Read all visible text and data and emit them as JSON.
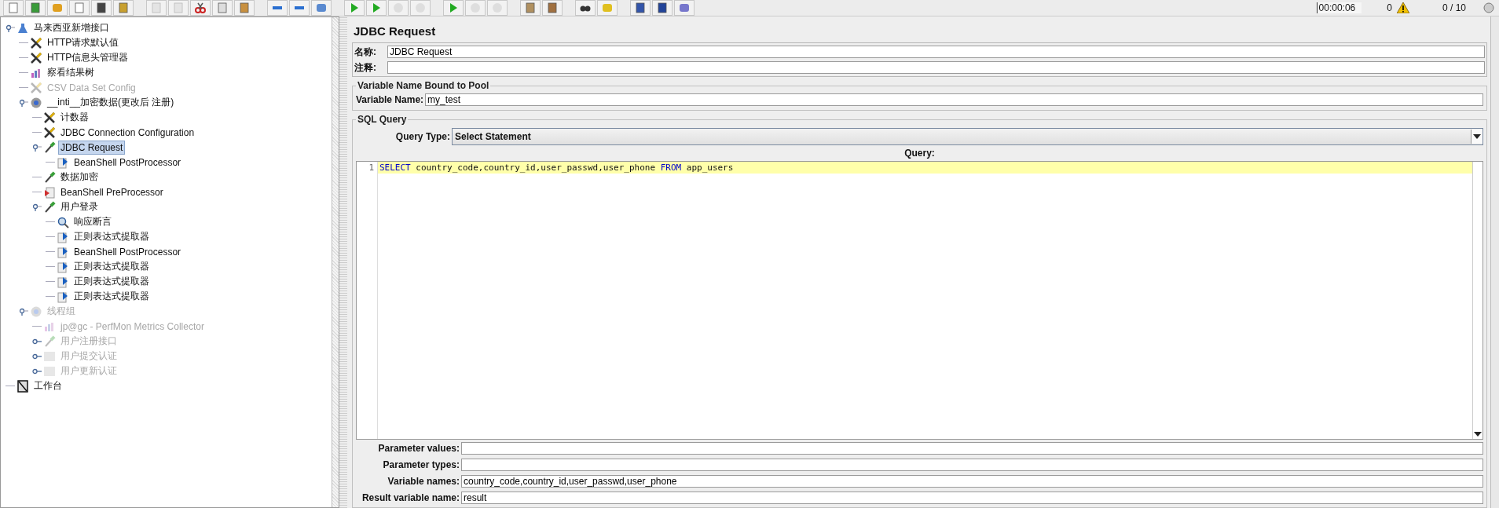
{
  "toolbar": {
    "buttons": [
      {
        "kind": "new",
        "disabled": false
      },
      {
        "kind": "templates",
        "disabled": false
      },
      {
        "kind": "open",
        "disabled": false
      },
      {
        "kind": "close",
        "disabled": false
      },
      {
        "kind": "save",
        "disabled": false
      },
      {
        "kind": "save-image",
        "disabled": false
      },
      {
        "kind": "undo",
        "disabled": true
      },
      {
        "kind": "redo",
        "disabled": true
      },
      {
        "kind": "cut",
        "disabled": false
      },
      {
        "kind": "copy",
        "disabled": false
      },
      {
        "kind": "paste",
        "disabled": false
      },
      {
        "kind": "expand",
        "disabled": false
      },
      {
        "kind": "collapse",
        "disabled": false
      },
      {
        "kind": "toggle",
        "disabled": false
      },
      {
        "kind": "start",
        "disabled": false
      },
      {
        "kind": "start-no-pause",
        "disabled": false
      },
      {
        "kind": "stop",
        "disabled": true
      },
      {
        "kind": "shutdown",
        "disabled": true
      },
      {
        "kind": "remote-start",
        "disabled": false
      },
      {
        "kind": "remote-stop",
        "disabled": true
      },
      {
        "kind": "remote-exit",
        "disabled": true
      },
      {
        "kind": "clear",
        "disabled": false
      },
      {
        "kind": "clear-all",
        "disabled": false
      },
      {
        "kind": "search",
        "disabled": false
      },
      {
        "kind": "reset-search",
        "disabled": false
      },
      {
        "kind": "function",
        "disabled": false
      },
      {
        "kind": "help",
        "disabled": false
      },
      {
        "kind": "log",
        "disabled": false
      }
    ],
    "elapsed": "00:00:06",
    "error_count": "0",
    "threads": "0 / 10"
  },
  "tree": [
    {
      "label": "马来西亚新增接口",
      "kind": "plan",
      "enabled": true,
      "selected": false,
      "expanded": true,
      "children": [
        {
          "label": "HTTP请求默认值",
          "kind": "config",
          "enabled": true,
          "selected": false
        },
        {
          "label": "HTTP信息头管理器",
          "kind": "config",
          "enabled": true,
          "selected": false
        },
        {
          "label": "察看结果树",
          "kind": "listener",
          "enabled": true,
          "selected": false
        },
        {
          "label": "CSV Data Set Config",
          "kind": "config",
          "enabled": false,
          "selected": false
        },
        {
          "label": "__inti__加密数据(更改后 注册)",
          "kind": "threadgroup",
          "enabled": true,
          "selected": false,
          "expanded": true,
          "children": [
            {
              "label": "计数器",
              "kind": "config",
              "enabled": true,
              "selected": false
            },
            {
              "label": "JDBC Connection Configuration",
              "kind": "config",
              "enabled": true,
              "selected": false
            },
            {
              "label": "JDBC Request",
              "kind": "sampler",
              "enabled": true,
              "selected": true,
              "expanded": true,
              "children": [
                {
                  "label": "BeanShell PostProcessor",
                  "kind": "post",
                  "enabled": true,
                  "selected": false
                }
              ]
            },
            {
              "label": "数据加密",
              "kind": "sampler",
              "enabled": true,
              "selected": false
            },
            {
              "label": "BeanShell PreProcessor",
              "kind": "pre",
              "enabled": true,
              "selected": false
            },
            {
              "label": "用户登录",
              "kind": "sampler",
              "enabled": true,
              "selected": false,
              "expanded": true,
              "children": [
                {
                  "label": "响应断言",
                  "kind": "assertion",
                  "enabled": true,
                  "selected": false
                },
                {
                  "label": "正则表达式提取器",
                  "kind": "post",
                  "enabled": true,
                  "selected": false
                },
                {
                  "label": "BeanShell PostProcessor",
                  "kind": "post",
                  "enabled": true,
                  "selected": false
                },
                {
                  "label": "正则表达式提取器",
                  "kind": "post",
                  "enabled": true,
                  "selected": false
                },
                {
                  "label": "正则表达式提取器",
                  "kind": "post",
                  "enabled": true,
                  "selected": false
                },
                {
                  "label": "正则表达式提取器",
                  "kind": "post",
                  "enabled": true,
                  "selected": false
                }
              ]
            }
          ]
        },
        {
          "label": "线程组",
          "kind": "threadgroup",
          "enabled": false,
          "selected": false,
          "expanded": true,
          "children": [
            {
              "label": "jp@gc - PerfMon Metrics Collector",
              "kind": "listener",
              "enabled": false,
              "selected": false
            },
            {
              "label": "用户注册接口",
              "kind": "sampler",
              "enabled": false,
              "selected": false,
              "expanded": false
            },
            {
              "label": "用户提交认证",
              "kind": "controller",
              "enabled": false,
              "selected": false,
              "expanded": false
            },
            {
              "label": "用户更新认证",
              "kind": "controller",
              "enabled": false,
              "selected": false,
              "expanded": false
            }
          ]
        }
      ]
    },
    {
      "label": "工作台",
      "kind": "workbench",
      "enabled": true,
      "selected": false
    }
  ],
  "panel": {
    "title": "JDBC Request",
    "name_label": "名称:",
    "name_value": "JDBC Request",
    "comment_label": "注释:",
    "pool": {
      "legend": "Variable Name Bound to Pool",
      "label": "Variable Name:",
      "value": "my_test"
    },
    "sql": {
      "legend": "SQL Query",
      "query_type_label": "Query Type:",
      "query_type": "Select Statement",
      "query_label": "Query:",
      "lines": [
        {
          "number": "1",
          "tokens": [
            {
              "text": "SELECT",
              "kind": "keyword"
            },
            {
              "text": " country_code,country_id,user_passwd,user_phone ",
              "kind": "plain"
            },
            {
              "text": "FROM",
              "kind": "keyword"
            },
            {
              "text": " app_users",
              "kind": "plain"
            }
          ]
        }
      ]
    },
    "params": [
      {
        "label": "Parameter values:"
      },
      {
        "label": "Parameter types:"
      },
      {
        "label": "Variable names:",
        "value": "country_code,country_id,user_passwd,user_phone"
      },
      {
        "label": "Result variable name:",
        "value": "result"
      }
    ]
  }
}
